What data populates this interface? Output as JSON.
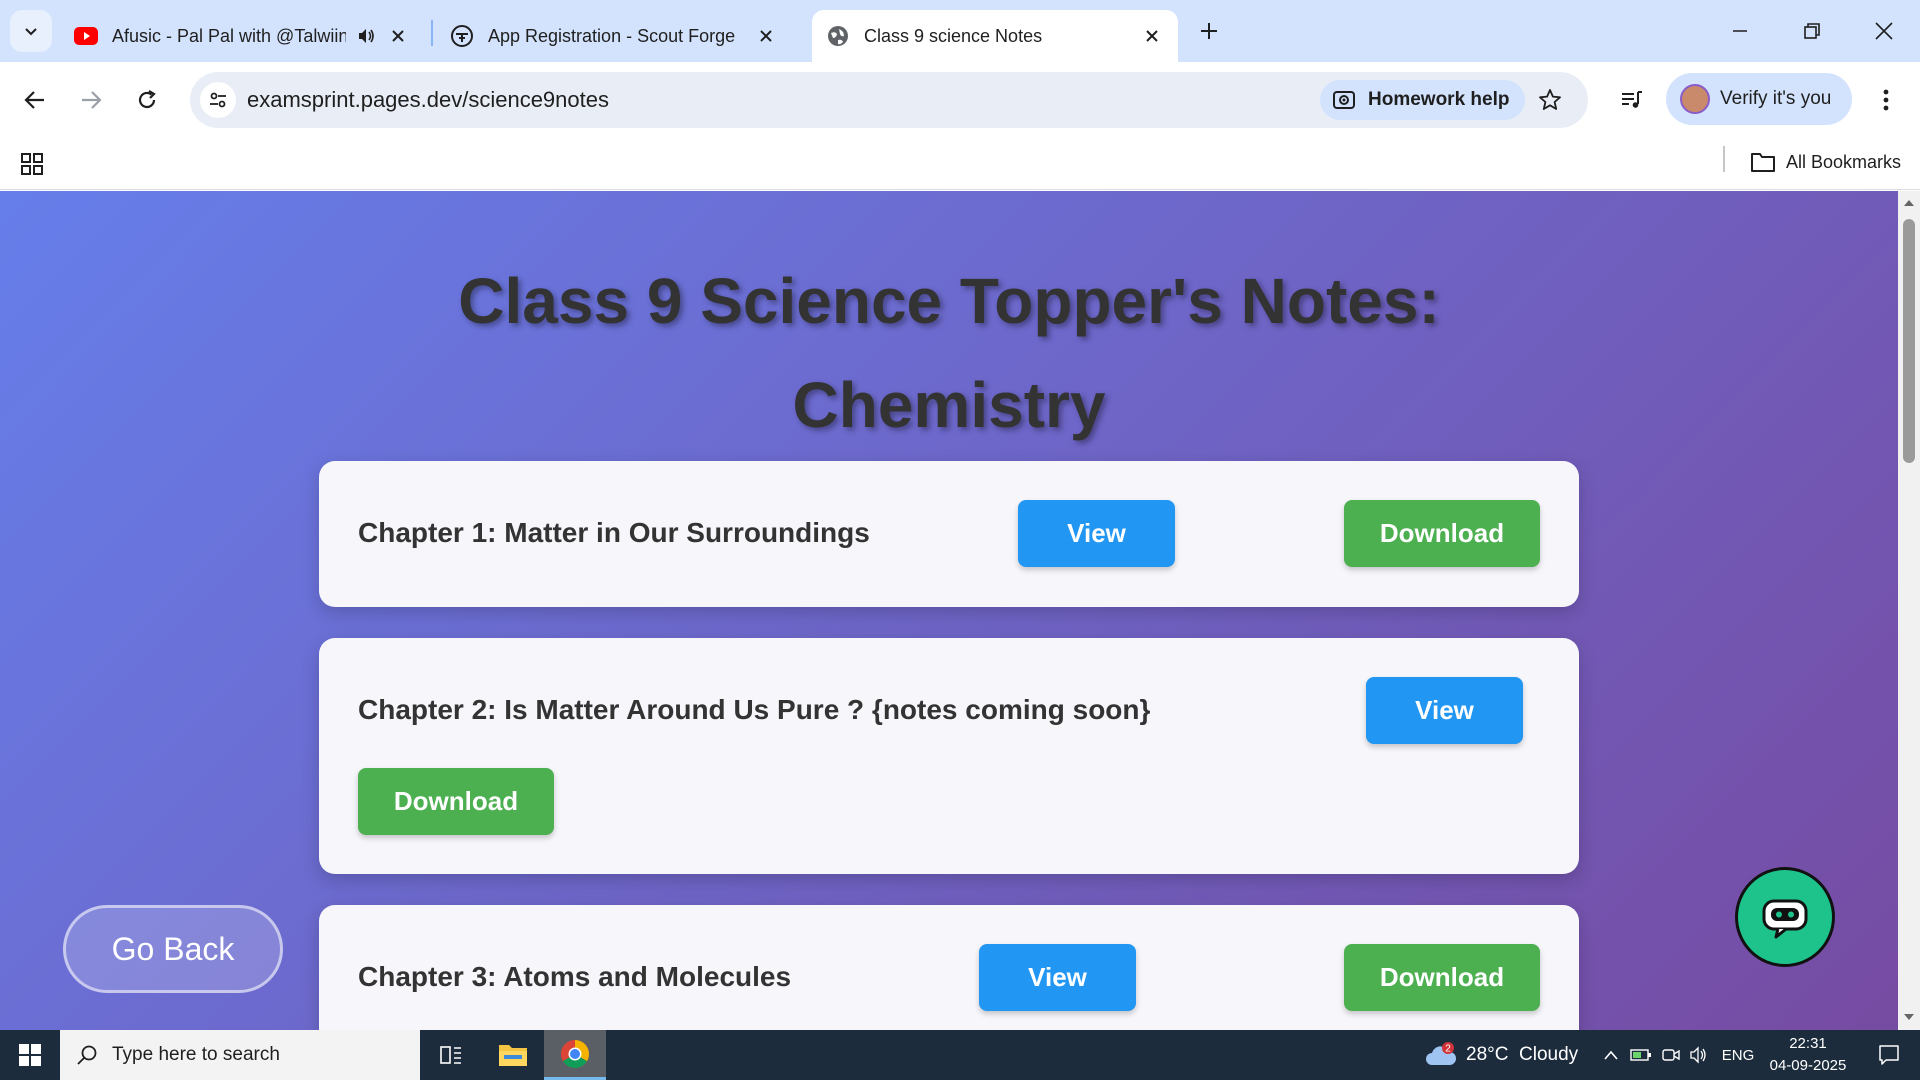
{
  "browser": {
    "tabs": [
      {
        "title": "Afusic - Pal Pal with @Talwiinder",
        "favicon": "youtube-icon",
        "audio": true
      },
      {
        "title": "App Registration - Scout Forge",
        "favicon": "scout-forge-icon"
      },
      {
        "title": "Class 9 science Notes",
        "favicon": "globe-icon",
        "active": true
      }
    ],
    "address": "examsprint.pages.dev/science9notes",
    "homework_help": "Homework help",
    "profile_label": "Verify it's you",
    "all_bookmarks": "All Bookmarks"
  },
  "page": {
    "title_line1": "Class 9 Science Topper's Notes:",
    "title_line2": "Chemistry",
    "chapters": [
      {
        "title": "Chapter 1: Matter in Our Surroundings",
        "view_label": "View",
        "download_label": "Download"
      },
      {
        "title": "Chapter 2: Is Matter Around Us Pure ? {notes coming soon}",
        "view_label": "View",
        "download_label": "Download"
      },
      {
        "title": "Chapter 3: Atoms and Molecules",
        "view_label": "View",
        "download_label": "Download"
      }
    ],
    "go_back": "Go Back",
    "colors": {
      "view": "#2196f3",
      "download": "#4caf50",
      "gradient_start": "#667eea",
      "gradient_end": "#764ba2"
    }
  },
  "taskbar": {
    "search_placeholder": "Type here to search",
    "weather": "28°C  Cloudy",
    "weather_badge": "2",
    "language": "ENG",
    "time": "22:31",
    "date": "04-09-2025"
  }
}
